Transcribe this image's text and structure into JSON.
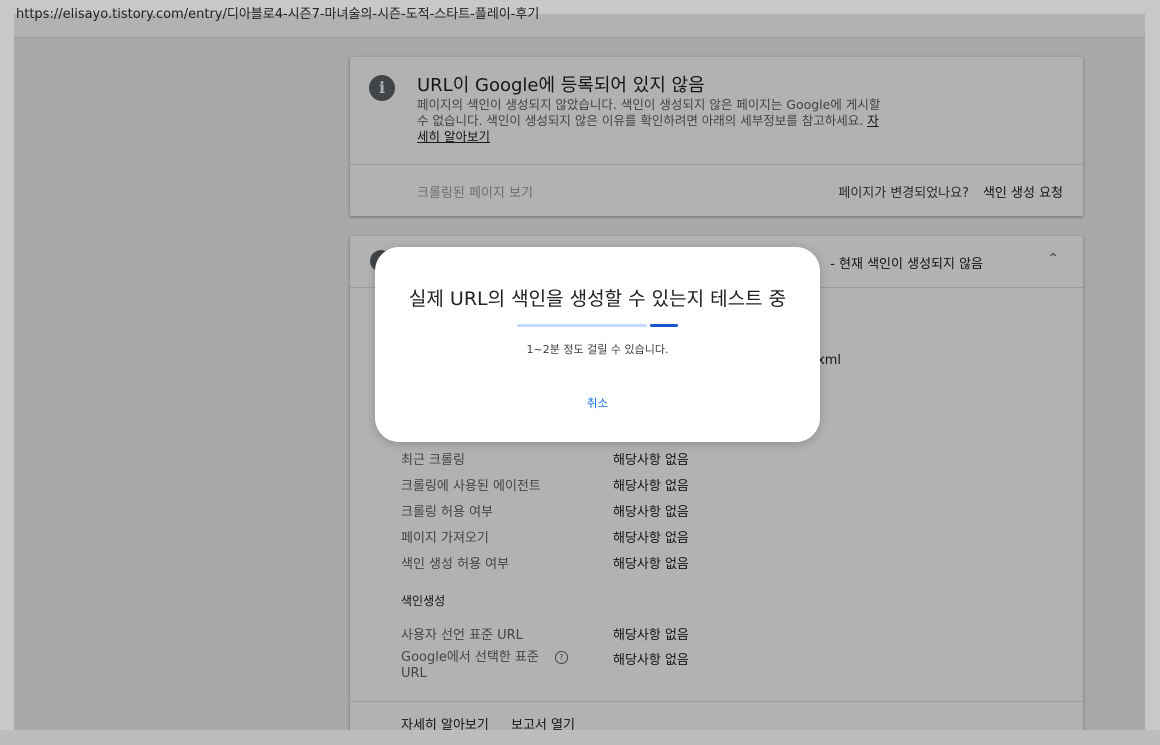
{
  "browser": {
    "url": "https://elisayo.tistory.com/entry/디아블로4-시즌7-마녀술의-시즌-도적-스타트-플레이-후기"
  },
  "status_card": {
    "icon": "info-icon",
    "title": "URL이 Google에 등록되어 있지 않음",
    "description": "페이지의 색인이 생성되지 않았습니다. 색인이 생성되지 않은 페이지는 Google에 게시할 수 없습니다. 색인이 생성되지 않은 이유를 확인하려면 아래의 세부정보를 참고하세요.",
    "learn_more": "자세히 알아보기",
    "view_crawled": "크롤링된 페이지 보기",
    "changed_question": "페이지가 변경되었나요?",
    "request_indexing": "색인 생성 요청"
  },
  "detail_card": {
    "header_tail": "- 현재 색인이 생성되지 않음",
    "sitemap_tail": "xml",
    "crawl_rows": [
      {
        "label": "최근 크롤링",
        "value": "해당사항 없음"
      },
      {
        "label": "크롤링에 사용된 에이전트",
        "value": "해당사항 없음"
      },
      {
        "label": "크롤링 허용 여부",
        "value": "해당사항 없음"
      },
      {
        "label": "페이지 가져오기",
        "value": "해당사항 없음"
      },
      {
        "label": "색인 생성 허용 여부",
        "value": "해당사항 없음"
      }
    ],
    "indexing_section": "색인생성",
    "index_rows": [
      {
        "label": "사용자 선언 표준 URL",
        "value": "해당사항 없음"
      },
      {
        "label_line1": "Google에서 선택한 표준",
        "label_line2": "URL",
        "value": "해당사항 없음"
      }
    ],
    "footer_learn_more": "자세히 알아보기",
    "footer_open_report": "보고서 열기"
  },
  "dialog": {
    "title": "실제 URL의 색인을 생성할 수 있는지 테스트 중",
    "subtitle": "1~2분 정도 걸릴 수 있습니다.",
    "cancel": "취소"
  },
  "colors": {
    "accent": "#1a73e8",
    "progress_fill": "#1a56c9",
    "progress_track": "#c6dafc"
  }
}
